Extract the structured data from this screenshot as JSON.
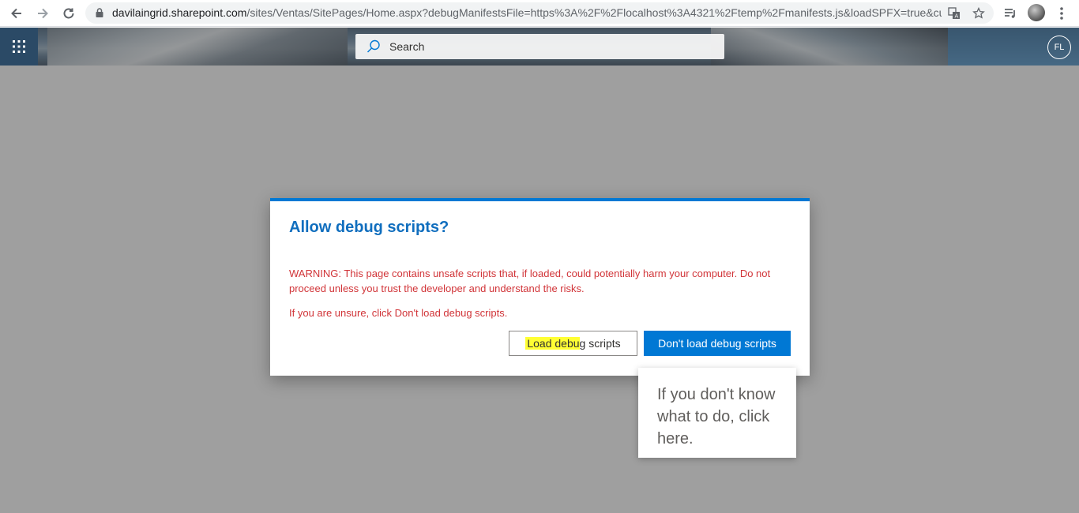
{
  "browser": {
    "url_host": "davilaingrid.sharepoint.com",
    "url_path": "/sites/Ventas/SitePages/Home.aspx?debugManifestsFile=https%3A%2F%2Flocalhost%3A4321%2Ftemp%2Fmanifests.js&loadSPFX=true&cu..."
  },
  "suite_bar": {
    "search_placeholder": "Search",
    "user_initials": "FL"
  },
  "dialog": {
    "title": "Allow debug scripts?",
    "warning": "WARNING: This page contains unsafe scripts that, if loaded, could potentially harm your computer. Do not proceed unless you trust the developer and understand the risks.",
    "unsure": "If you are unsure, click Don't load debug scripts.",
    "load_button_highlighted": "Load debu",
    "load_button_rest": "g scripts",
    "dont_load_button": "Don't load debug scripts"
  },
  "callout": {
    "text": "If you don't know what to do, click here."
  },
  "colors": {
    "accent": "#0078d4",
    "title": "#106ebe",
    "warning": "#d13438",
    "highlight": "#ffff33"
  }
}
